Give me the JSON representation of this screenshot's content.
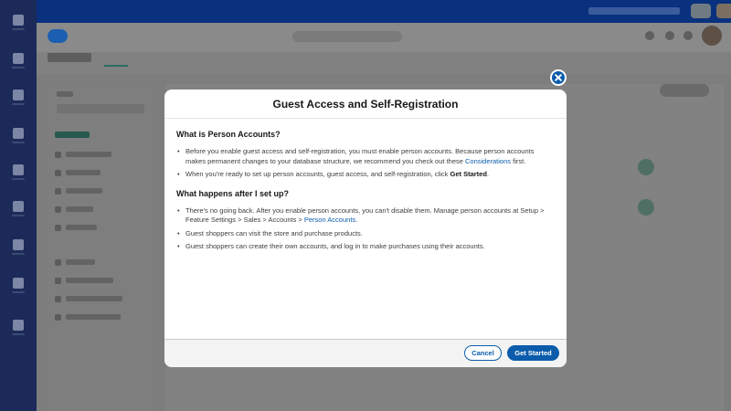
{
  "modal": {
    "title": "Guest Access and Self-Registration",
    "section1": {
      "heading": "What is Person Accounts?",
      "b1_text": "Before you enable guest access and self-registration, you must enable person accounts. Because person accounts makes permanent changes to your database structure, we recommend you check out these ",
      "b1_link": "Considerations",
      "b1_end": " first.",
      "b2_text": "When you're ready to set up person accounts, guest access, and self-registration, click ",
      "b2_bold": "Get Started",
      "b2_end": "."
    },
    "section2": {
      "heading": "What happens after I set up?",
      "b1_text": "There's no going back. After you enable person accounts, you can't disable them. Manage person accounts at Setup > Feature Settings > Sales > Accounts > ",
      "b1_link": "Person Accounts",
      "b1_end": ".",
      "b2_text": "Guest shoppers can visit the store and purchase products.",
      "b3_text": "Guest shoppers can create their own accounts, and log in to make purchases using their accounts."
    },
    "cancel_label": "Cancel",
    "start_label": "Get Started"
  },
  "icons": {
    "close": "close-icon",
    "cloud": "salesforce-cloud-icon"
  },
  "colors": {
    "brand": "#0b5cab",
    "overlay": "#7d7d7d",
    "nav": "#1b2a59"
  }
}
